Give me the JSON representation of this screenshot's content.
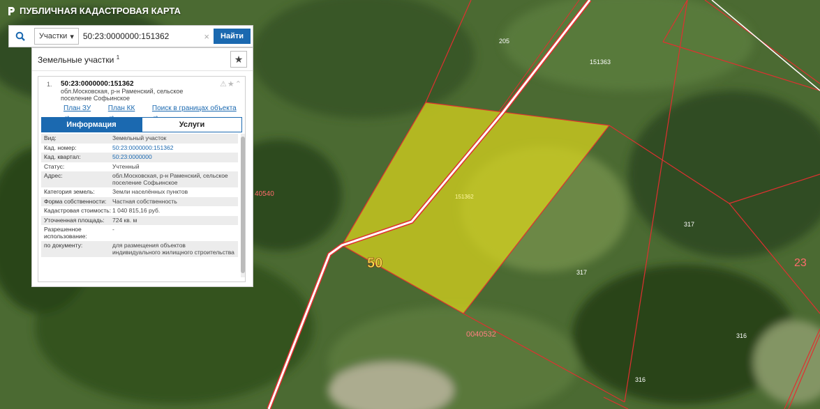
{
  "app": {
    "title": "ПУБЛИЧНАЯ КАДАСТРОВАЯ КАРТА"
  },
  "search": {
    "type_label": "Участки",
    "value": "50:23:0000000:151362",
    "submit_label": "Найти"
  },
  "panel": {
    "heading": "Земельные участки",
    "heading_sup": "1"
  },
  "result": {
    "index": "1.",
    "cad_number": "50:23:0000000:151362",
    "address": "обл.Московская, р-н Раменский, сельское поселение Софьинское",
    "links": [
      "План ЗУ →",
      "План КК →",
      "Поиск в границах объекта →"
    ]
  },
  "tabs": {
    "info": "Информация",
    "services": "Услуги"
  },
  "info_rows": [
    {
      "k": "Вид:",
      "v": "Земельный участок"
    },
    {
      "k": "Кад. номер:",
      "v": "50:23:0000000:151362"
    },
    {
      "k": "Кад. квартал:",
      "v": "50:23:0000000"
    },
    {
      "k": "Статус:",
      "v": "Учтенный"
    },
    {
      "k": "Адрес:",
      "v": "обл.Московская, р-н Раменский, сельское поселение Софьинское"
    },
    {
      "k": "Категория земель:",
      "v": "Земли населённых пунктов"
    },
    {
      "k": "Форма собственности:",
      "v": "Частная собственность"
    },
    {
      "k": "Кадастровая стоимость:",
      "v": "1 040 815,16 руб."
    },
    {
      "k": "Уточненная площадь:",
      "v": "724 кв. м"
    },
    {
      "k": "Разрешенное использование:",
      "v": "-"
    },
    {
      "k": "по документу:",
      "v": "для размещения объектов индивидуального жилищного строительства"
    }
  ],
  "map_labels": {
    "l205": "205",
    "l151363": "151363",
    "l151362": "151362",
    "l40540": "40540",
    "l50": "50",
    "l317a": "317",
    "l317b": "317",
    "l23": "23",
    "l40532": "0040532",
    "l316a": "316",
    "l316b": "316"
  },
  "colors": {
    "accent": "#1b69b0",
    "parcel_fill": "#d6d21e",
    "boundary": "#e03030"
  }
}
